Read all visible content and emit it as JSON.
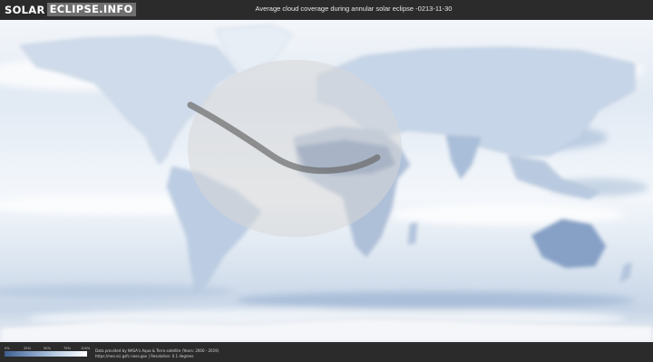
{
  "header": {
    "logo_part1": "SOLAR",
    "logo_part2": "ECLIPSE.INFO",
    "title": "Average cloud coverage during annular solar eclipse -0213-11-30"
  },
  "legend": {
    "ticks": [
      "0%",
      "25%",
      "50%",
      "75%",
      "100%"
    ],
    "colors": [
      "#3f5f8f",
      "#7f9bc3",
      "#c3d3e8",
      "#ffffff"
    ]
  },
  "footer": {
    "credit_line1": "Data provided by NASA's Aqua & Terra satellite (Years: 2000 - 2019)",
    "credit_line2": "https://neo.sci.gsfc.nasa.gov | Resolution: 0.1 degrees"
  },
  "map": {
    "type": "world cloud coverage",
    "colors": {
      "ocean": "#eef3f9",
      "cloud_low": "#7f9bc3",
      "visibility_zone": "#d7d7d7",
      "central_path": "#6a6a6a"
    }
  }
}
